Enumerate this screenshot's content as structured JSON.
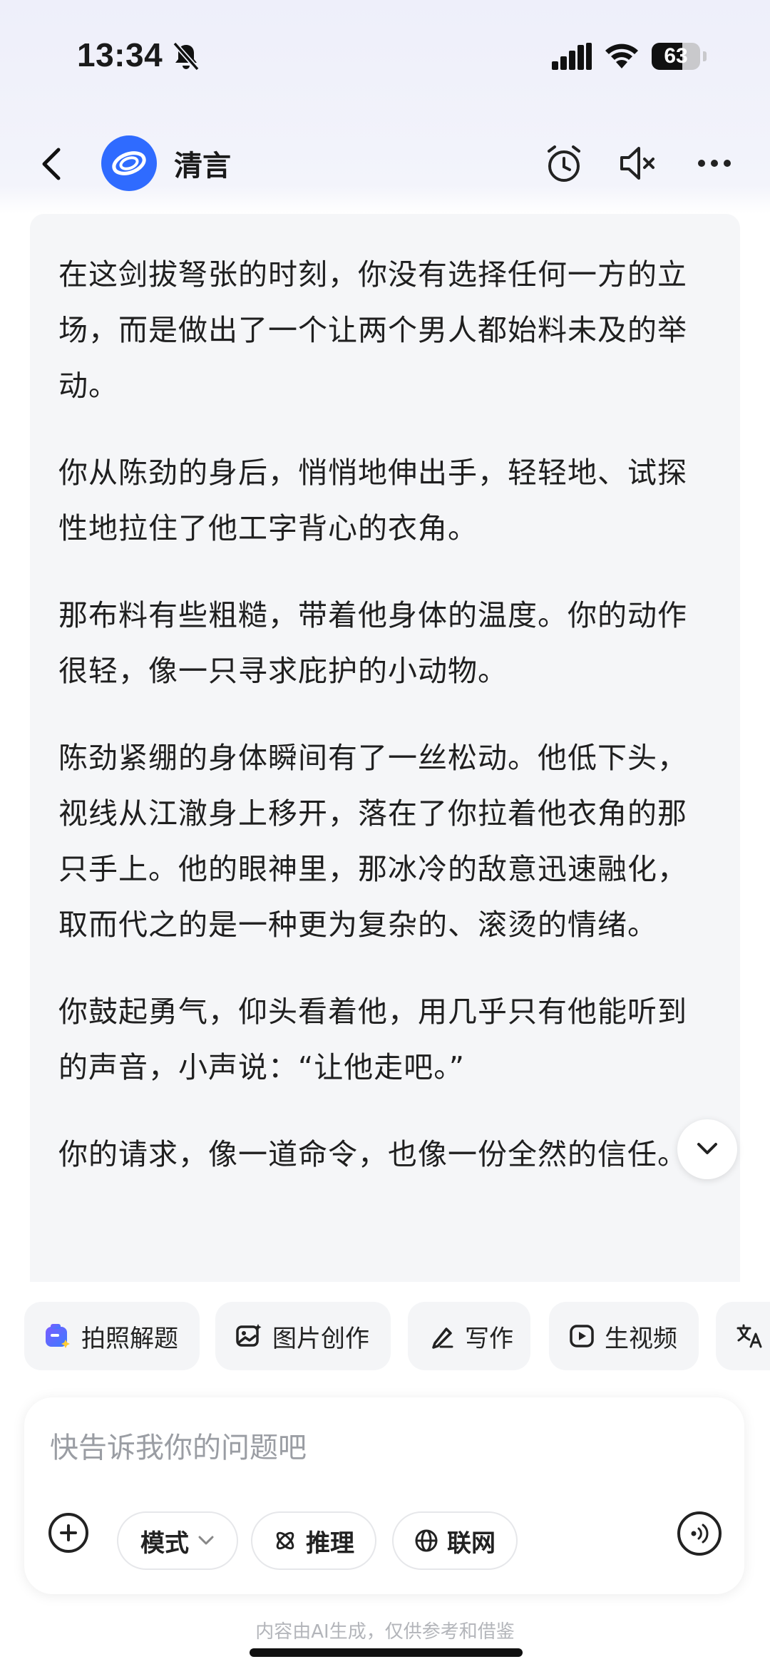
{
  "status_bar": {
    "time": "13:34",
    "battery_level": 63,
    "battery_label": "63",
    "icons": [
      "bell-off-icon",
      "signal-icon",
      "wifi-icon",
      "battery-icon"
    ]
  },
  "header": {
    "bot_name": "清言",
    "icons": [
      "back-icon",
      "bot-avatar",
      "alarm-icon",
      "mute-icon",
      "more-icon"
    ]
  },
  "message": {
    "paragraphs": [
      "在这剑拔弩张的时刻，你没有选择任何一方的立场，而是做出了一个让两个男人都始料未及的举动。",
      "你从陈劲的身后，悄悄地伸出手，轻轻地、试探性地拉住了他工字背心的衣角。",
      "那布料有些粗糙，带着他身体的温度。你的动作很轻，像一只寻求庇护的小动物。",
      "陈劲紧绷的身体瞬间有了一丝松动。他低下头，视线从江澈身上移开，落在了你拉着他衣角的那只手上。他的眼神里，那冰冷的敌意迅速融化，取而代之的是一种更为复杂的、滚烫的情绪。",
      "你鼓起勇气，仰头看着他，用几乎只有他能听到的声音，小声说：“让他走吧。”",
      "你的请求，像一道命令，也像一份全然的信任。"
    ]
  },
  "quick_actions": [
    {
      "label": "拍照解题",
      "icon": "photo-solve-icon"
    },
    {
      "label": "图片创作",
      "icon": "image-create-icon"
    },
    {
      "label": "写作",
      "icon": "pen-icon"
    },
    {
      "label": "生视频",
      "icon": "video-icon"
    },
    {
      "label": "",
      "icon": "translate-icon"
    }
  ],
  "input": {
    "placeholder": "快告诉我你的问题吧",
    "value": "",
    "mode_label": "模式",
    "reasoning_label": "推理",
    "web_label": "联网"
  },
  "footer": {
    "disclaimer": "内容由AI生成，仅供参考和借鉴"
  },
  "colors": {
    "accent": "#2f6bff",
    "card_background": "#f5f6f8",
    "photo_icon_gradient": [
      "#6b5cff",
      "#3c7bff"
    ]
  }
}
